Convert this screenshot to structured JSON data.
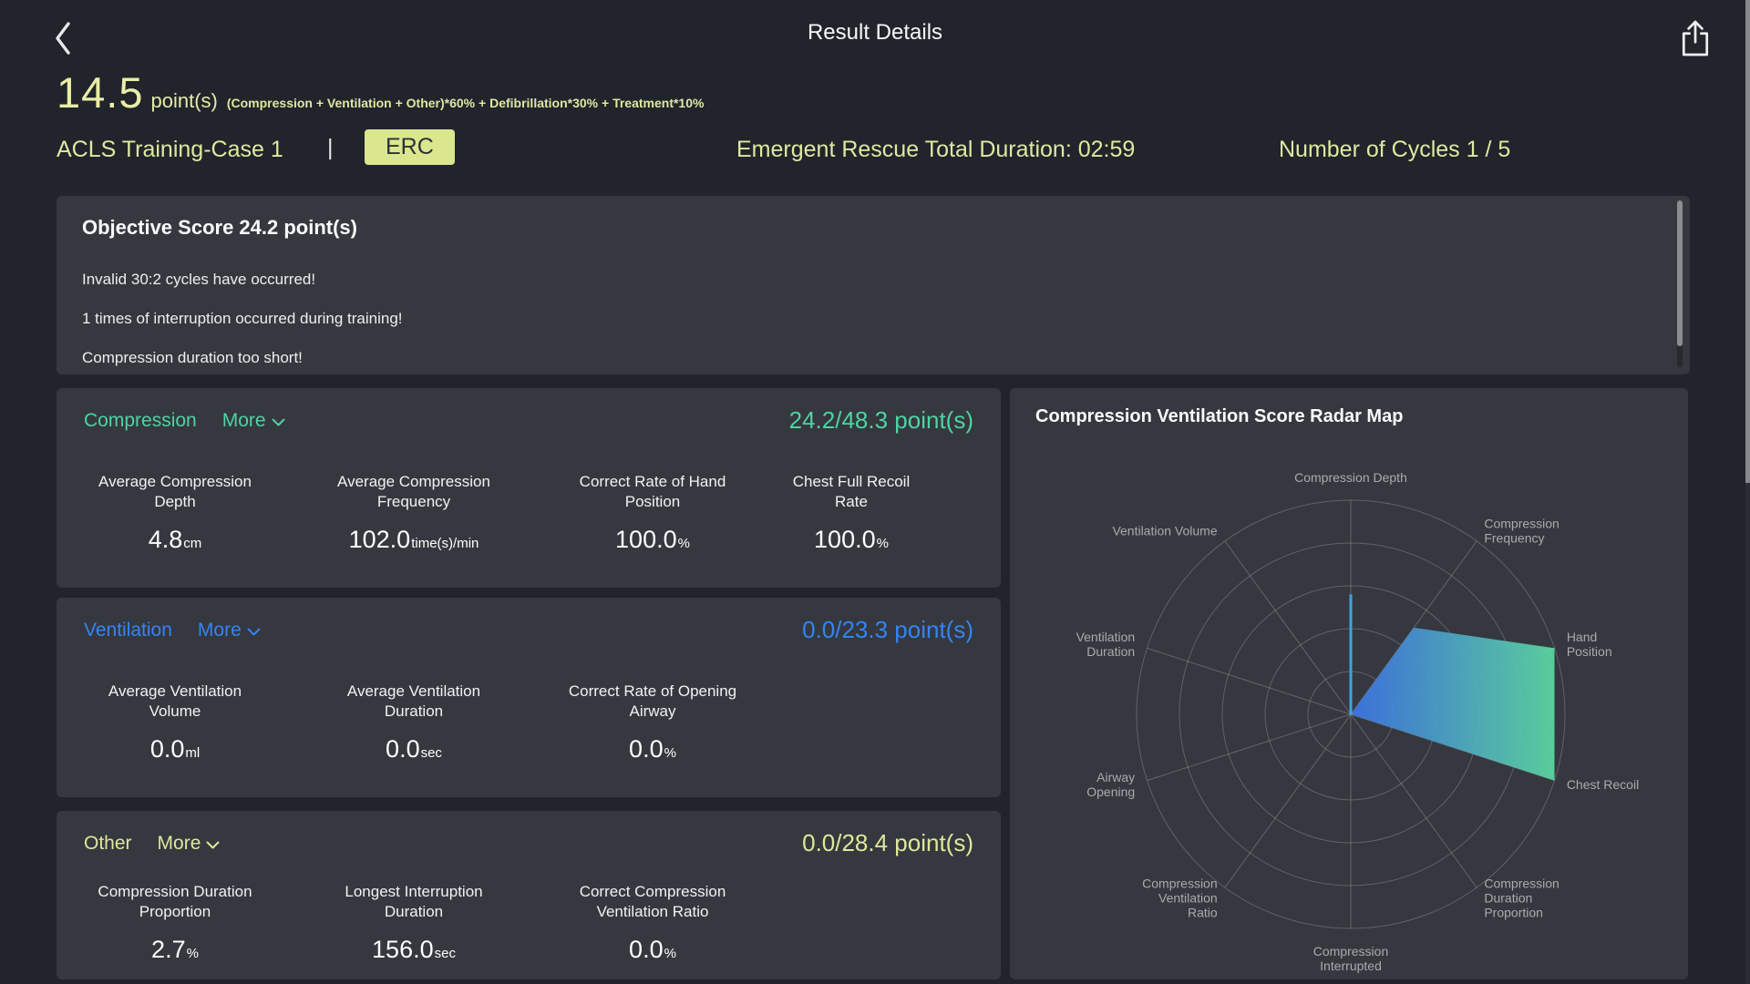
{
  "theme": {
    "page_bg": "#21242b",
    "panel_bg": "#35383e",
    "yellow_accent": "#dfe8a1",
    "green_accent": "#4ed3a2",
    "blue_accent": "#3484f6",
    "badge_bg": "#dbe78e"
  },
  "header": {
    "title": "Result Details"
  },
  "score_summary": {
    "value": "14.5",
    "unit": "point(s)",
    "formula": "(Compression + Ventilation + Other)*60% + Defibrillation*30% + Treatment*10%"
  },
  "session": {
    "case_name": "ACLS Training-Case 1",
    "separator": "|",
    "protocol": "ERC",
    "duration": "Emergent Rescue Total Duration: 02:59",
    "cycles": "Number of Cycles 1 / 5"
  },
  "objective": {
    "title": "Objective Score 24.2 point(s)",
    "messages": [
      "Invalid 30:2 cycles have occurred!",
      "1 times of interruption occurred during training!",
      "Compression duration too short!"
    ]
  },
  "sections": [
    {
      "title": "Compression",
      "more_label": "More",
      "score": "24.2/48.3 point(s)",
      "accent": "#4ed3a2",
      "stats": [
        {
          "label_lines": [
            "Average Compression",
            "Depth"
          ],
          "value": "4.8",
          "unit": "cm"
        },
        {
          "label_lines": [
            "Average Compression",
            "Frequency"
          ],
          "value": "102.0",
          "unit": "time(s)/min"
        },
        {
          "label_lines": [
            "Correct Rate of Hand",
            "Position"
          ],
          "value": "100.0",
          "unit": "%"
        },
        {
          "label_lines": [
            "Chest Full Recoil",
            "Rate"
          ],
          "value": "100.0",
          "unit": "%"
        }
      ]
    },
    {
      "title": "Ventilation",
      "more_label": "More",
      "score": "0.0/23.3 point(s)",
      "accent": "#3484f6",
      "stats": [
        {
          "label_lines": [
            "Average Ventilation",
            "Volume"
          ],
          "value": "0.0",
          "unit": "ml"
        },
        {
          "label_lines": [
            "Average Ventilation",
            "Duration"
          ],
          "value": "0.0",
          "unit": "sec"
        },
        {
          "label_lines": [
            "Correct Rate of Opening",
            "Airway"
          ],
          "value": "0.0",
          "unit": "%"
        }
      ]
    },
    {
      "title": "Other",
      "more_label": "More",
      "score": "0.0/28.4 point(s)",
      "accent": "#dfe79b",
      "stats": [
        {
          "label_lines": [
            "Compression Duration",
            "Proportion"
          ],
          "value": "2.7",
          "unit": "%"
        },
        {
          "label_lines": [
            "Longest Interruption",
            "Duration"
          ],
          "value": "156.0",
          "unit": "sec"
        },
        {
          "label_lines": [
            "Correct Compression",
            "Ventilation Ratio"
          ],
          "value": "0.0",
          "unit": "%"
        }
      ]
    }
  ],
  "chart_data": {
    "type": "radar",
    "title": "Compression Ventilation Score Radar Map",
    "indicators": [
      "Compression Depth",
      "Compression Frequency",
      "Hand Position",
      "Chest Recoil",
      "Compression Duration Proportion",
      "Compression Interrupted",
      "Compression Ventilation Ratio",
      "Airway Opening",
      "Ventilation Duration",
      "Ventilation Volume"
    ],
    "max": 100,
    "rings": 5,
    "values": [
      56,
      50,
      100,
      100,
      0,
      0,
      0,
      0,
      0,
      0
    ],
    "render": {
      "label_lines": [
        [
          "Compression Depth"
        ],
        [
          "Compression",
          "Frequency"
        ],
        [
          "Hand",
          "Position"
        ],
        [
          "Chest Recoil"
        ],
        [
          "Compression",
          "Duration",
          "Proportion"
        ],
        [
          "Compression",
          "Interrupted"
        ],
        [
          "Compression",
          "Ventilation",
          "Ratio"
        ],
        [
          "Airway",
          "Opening"
        ],
        [
          "Ventilation",
          "Duration"
        ],
        [
          "Ventilation Volume"
        ]
      ],
      "polygon": [
        {
          "axis": "Compression Frequency",
          "value": 50
        },
        {
          "axis": "Hand Position",
          "value": 100
        },
        {
          "axis": "Chest Recoil",
          "value": 100
        }
      ],
      "spike": {
        "axis": "Compression Depth",
        "value": 56,
        "color": "#3ea2e5"
      },
      "gradient": [
        "#3c74e6",
        "#5cd9a4"
      ],
      "grid_color": "#8a8d92",
      "spoke_color": "#b9bbbe",
      "label_color": "#a8abaf"
    }
  }
}
